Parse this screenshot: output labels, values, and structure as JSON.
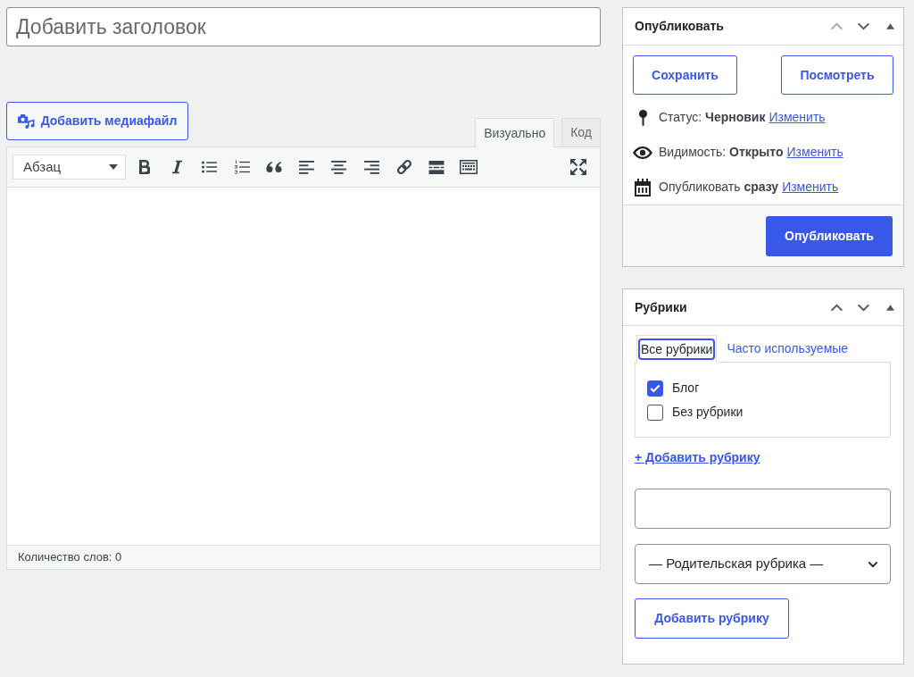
{
  "title_field": {
    "placeholder": "Добавить заголовок"
  },
  "media_button": "Добавить медиафайл",
  "editor": {
    "tabs": [
      {
        "label": "Визуально",
        "selected": true
      },
      {
        "label": "Код",
        "selected": false
      }
    ],
    "format_select": {
      "value": "Абзац"
    },
    "status_bar": {
      "word_count": "Количество слов: 0"
    }
  },
  "publish_box": {
    "title": "Опубликовать",
    "move_up_disabled": true,
    "buttons": [
      "Сохранить",
      "Посмотреть"
    ],
    "meta": [
      {
        "kind": "status",
        "text": "Статус: **Черновик**",
        "link": "Изменить"
      },
      {
        "kind": "visibility",
        "text": "Видимость: **Открыто**",
        "link": "Изменить"
      },
      {
        "kind": "schedule",
        "text": "Опубликовать **сразу**",
        "link": "Изменить"
      }
    ],
    "publish_button": "Опубликовать"
  },
  "categories_box": {
    "title": "Рубрики",
    "move_up_disabled": false,
    "tabs": [
      {
        "label": "Все рубрики",
        "selected": true
      },
      {
        "label": "Часто используемые",
        "selected": false
      }
    ],
    "categories": [
      {
        "label": "Блог",
        "checked": true
      },
      {
        "label": "Без рубрики",
        "checked": false
      }
    ],
    "add_link": "+ Добавить рубрику",
    "parent_select": {
      "value": "— Родительская рубрика —"
    },
    "add_button": "Добавить рубрику"
  }
}
